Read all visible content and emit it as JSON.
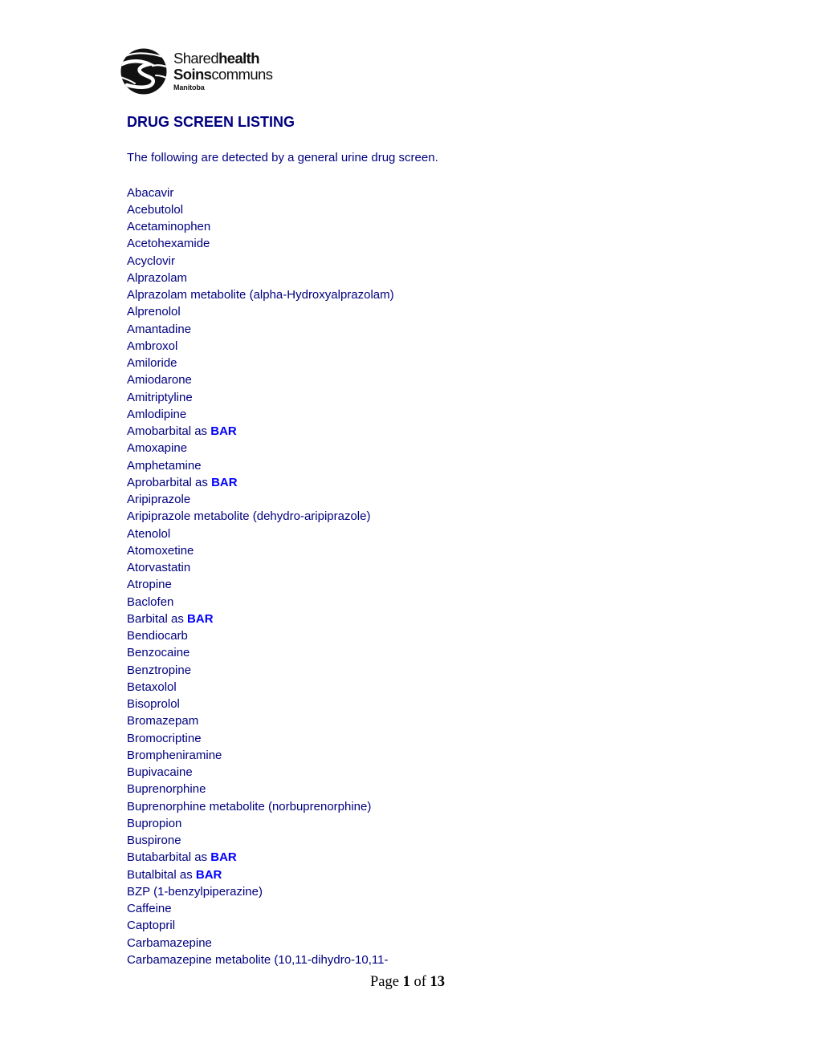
{
  "logo": {
    "icon": "shared-health-swirl-logo",
    "line1_light": "Shared",
    "line1_bold": "health",
    "line2_bold": "Soins",
    "line2_light": "communs",
    "line3": "Manitoba"
  },
  "document": {
    "title": "DRUG SCREEN LISTING",
    "intro": "The following are detected by a general urine drug screen.",
    "bar_label": "BAR",
    "colors": {
      "text": "#000080",
      "bar_highlight": "#0000ff"
    }
  },
  "drugs": [
    {
      "name": "Abacavir"
    },
    {
      "name": "Acebutolol"
    },
    {
      "name": "Acetaminophen"
    },
    {
      "name": "Acetohexamide"
    },
    {
      "name": "Acyclovir"
    },
    {
      "name": "Alprazolam"
    },
    {
      "name": "Alprazolam metabolite (alpha-Hydroxyalprazolam)"
    },
    {
      "name": "Alprenolol"
    },
    {
      "name": "Amantadine"
    },
    {
      "name": "Ambroxol"
    },
    {
      "name": "Amiloride"
    },
    {
      "name": "Amiodarone"
    },
    {
      "name": "Amitriptyline"
    },
    {
      "name": "Amlodipine"
    },
    {
      "name": "Amobarbital as",
      "tag": "BAR"
    },
    {
      "name": "Amoxapine"
    },
    {
      "name": "Amphetamine"
    },
    {
      "name": "Aprobarbital as",
      "tag": "BAR"
    },
    {
      "name": "Aripiprazole"
    },
    {
      "name": "Aripiprazole metabolite (dehydro-aripiprazole)"
    },
    {
      "name": "Atenolol"
    },
    {
      "name": "Atomoxetine"
    },
    {
      "name": "Atorvastatin"
    },
    {
      "name": "Atropine"
    },
    {
      "name": "Baclofen"
    },
    {
      "name": "Barbital as",
      "tag": "BAR"
    },
    {
      "name": "Bendiocarb"
    },
    {
      "name": "Benzocaine"
    },
    {
      "name": "Benztropine"
    },
    {
      "name": "Betaxolol"
    },
    {
      "name": "Bisoprolol"
    },
    {
      "name": "Bromazepam"
    },
    {
      "name": "Bromocriptine"
    },
    {
      "name": "Brompheniramine"
    },
    {
      "name": "Bupivacaine"
    },
    {
      "name": "Buprenorphine"
    },
    {
      "name": "Buprenorphine metabolite (norbuprenorphine)"
    },
    {
      "name": "Bupropion"
    },
    {
      "name": "Buspirone"
    },
    {
      "name": "Butabarbital as",
      "tag": "BAR"
    },
    {
      "name": "Butalbital as",
      "tag": "BAR"
    },
    {
      "name": "BZP (1-benzylpiperazine)"
    },
    {
      "name": "Caffeine"
    },
    {
      "name": "Captopril"
    },
    {
      "name": "Carbamazepine"
    },
    {
      "name": "Carbamazepine metabolite (10,11-dihydro-10,11-"
    }
  ],
  "footer": {
    "page_word": "Page",
    "current_page": "1",
    "of_word": "of",
    "total_pages": "13"
  }
}
